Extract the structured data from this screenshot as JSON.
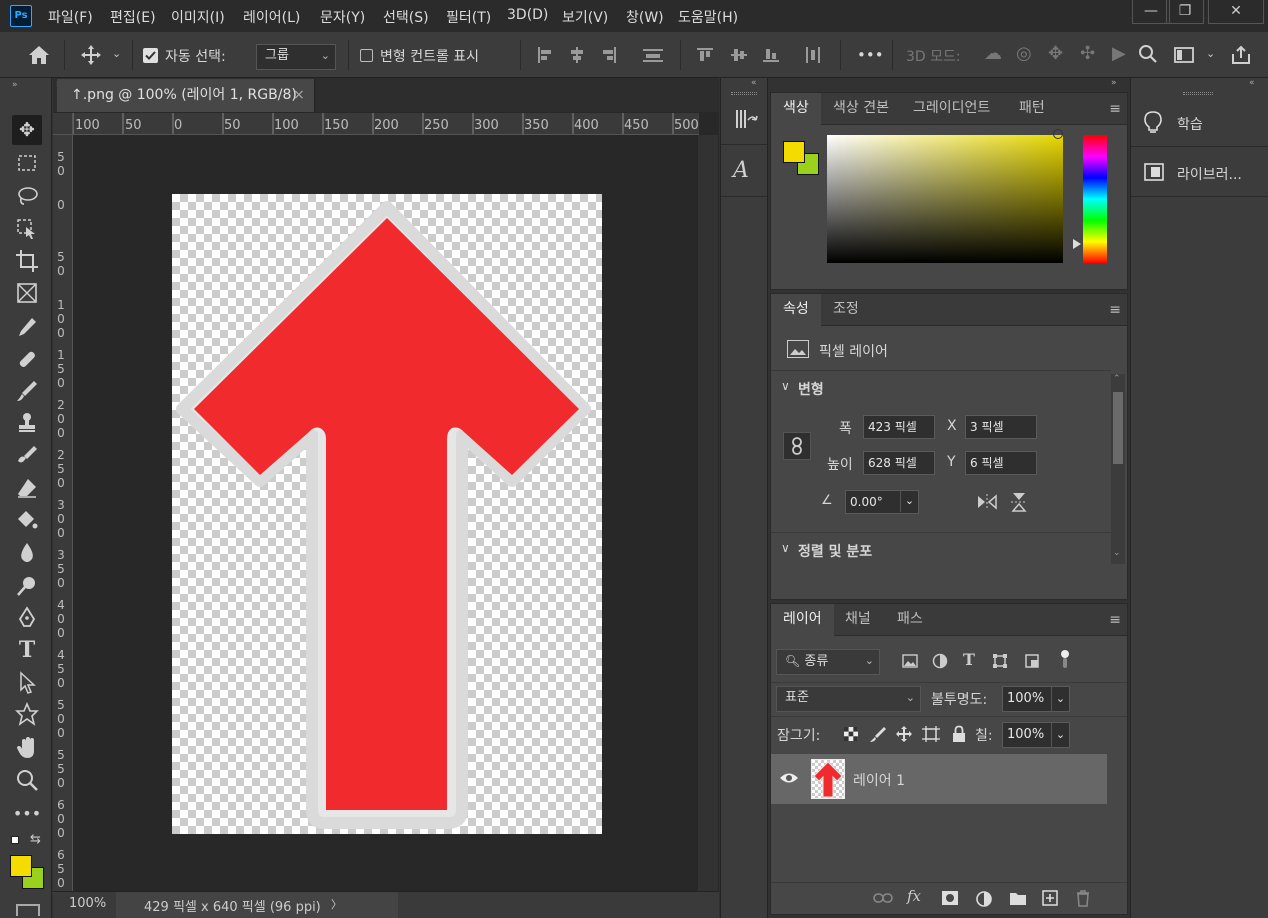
{
  "app": {
    "logo": "Ps"
  },
  "menu": [
    "파일(F)",
    "편집(E)",
    "이미지(I)",
    "레이어(L)",
    "문자(Y)",
    "선택(S)",
    "필터(T)",
    "3D(D)",
    "보기(V)",
    "창(W)",
    "도움말(H)"
  ],
  "window": {
    "minimize": "—",
    "maximize": "❐",
    "close": "✕"
  },
  "options": {
    "auto_select_label": "자동 선택:",
    "auto_select_value": "그룹",
    "transform_label": "변형 컨트롤 표시",
    "more": "•••",
    "mode3d_label": "3D 모드:"
  },
  "document": {
    "tab_title": "↑.png @ 100% (레이어 1, RGB/8)",
    "tab_close": "×",
    "zoom": "100%",
    "info": "429 픽셀 x 640 픽셀 (96 ppi)",
    "info_arrow": "〉"
  },
  "ruler": {
    "h": [
      "100",
      "50",
      "0",
      "50",
      "100",
      "150",
      "200",
      "250",
      "300",
      "350",
      "400",
      "450",
      "500"
    ],
    "v": [
      "5",
      "0",
      "0",
      "5",
      "0",
      "1",
      "0",
      "0",
      "1",
      "5",
      "0",
      "2",
      "0",
      "0",
      "2",
      "5",
      "0",
      "3",
      "0",
      "0",
      "3",
      "5",
      "0",
      "4",
      "0",
      "0",
      "4",
      "5",
      "0",
      "5",
      "0",
      "0",
      "5",
      "5",
      "0",
      "6",
      "0",
      "0",
      "6",
      "5",
      "0"
    ]
  },
  "color_panel": {
    "tabs": [
      "색상",
      "색상 견본",
      "그레이디언트",
      "패턴"
    ],
    "fg": "#f5dc00",
    "bg": "#9ad11c",
    "field_hue": "#e8d800"
  },
  "properties": {
    "tabs": [
      "속성",
      "조정"
    ],
    "type": "픽셀 레이어",
    "transform_header": "변형",
    "width_label": "폭",
    "width": "423 픽셀",
    "x_label": "X",
    "x": "3 픽셀",
    "height_label": "높이",
    "height": "628 픽셀",
    "y_label": "Y",
    "y": "6 픽셀",
    "angle": "0.00°",
    "align_header": "정렬 및 분포"
  },
  "layers": {
    "tabs": [
      "레이어",
      "채널",
      "패스"
    ],
    "filter": "종류",
    "blend": "표준",
    "opacity_label": "불투명도:",
    "opacity": "100%",
    "lock_label": "잠그기:",
    "fill_label": "칠:",
    "fill": "100%",
    "items": [
      {
        "name": "레이어 1"
      }
    ]
  },
  "right_panels": {
    "learn": "학습",
    "libraries": "라이브러..."
  },
  "colors": {
    "arrow_fill": "#f02a2d",
    "arrow_outline": "#e6e6e6"
  }
}
